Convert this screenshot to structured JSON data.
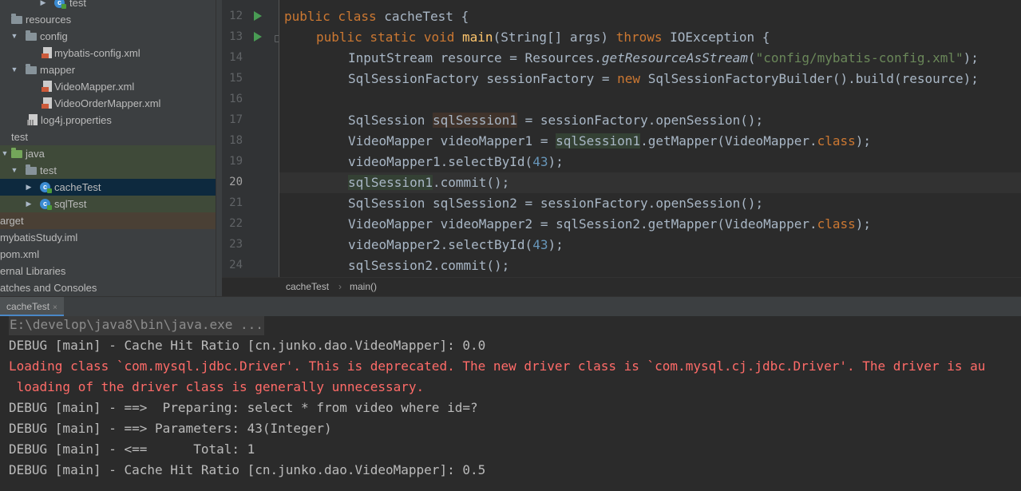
{
  "project_tree": {
    "items": [
      {
        "label": "test",
        "icon": "class-icon"
      },
      {
        "label": "resources",
        "icon": "folder-icon"
      },
      {
        "label": "config",
        "icon": "folder-icon"
      },
      {
        "label": "mybatis-config.xml",
        "icon": "xml-file-icon"
      },
      {
        "label": "mapper",
        "icon": "folder-icon"
      },
      {
        "label": "VideoMapper.xml",
        "icon": "xml-file-icon"
      },
      {
        "label": "VideoOrderMapper.xml",
        "icon": "xml-file-icon"
      },
      {
        "label": "log4j.properties",
        "icon": "properties-file-icon"
      },
      {
        "label": "test",
        "icon": "none"
      },
      {
        "label": "java",
        "icon": "source-folder-icon"
      },
      {
        "label": "test",
        "icon": "folder-icon"
      },
      {
        "label": "cacheTest",
        "icon": "class-icon"
      },
      {
        "label": "sqlTest",
        "icon": "class-icon"
      },
      {
        "label": "arget",
        "icon": "none"
      },
      {
        "label": "mybatisStudy.iml",
        "icon": "none"
      },
      {
        "label": "pom.xml",
        "icon": "none"
      },
      {
        "label": "ernal Libraries",
        "icon": "none"
      },
      {
        "label": "atches and Consoles",
        "icon": "none"
      }
    ]
  },
  "editor": {
    "line_numbers": [
      "12",
      "13",
      "14",
      "15",
      "16",
      "17",
      "18",
      "19",
      "20",
      "21",
      "22",
      "23",
      "24"
    ],
    "current_line": "20",
    "lines": {
      "l12": {
        "a": "public class ",
        "b": "cacheTest {"
      },
      "l13": {
        "a": "public static void ",
        "b": "main",
        "c": "(String[] args) ",
        "d": "throws ",
        "e": "IOException {"
      },
      "l14": {
        "a": "InputStream resource = Resources.",
        "b": "getResourceAsStream",
        "c": "(",
        "d": "\"config/mybatis-config.xml\"",
        "e": ");"
      },
      "l15": {
        "a": "SqlSessionFactory sessionFactory = ",
        "b": "new ",
        "c": "SqlSessionFactoryBuilder().build(resource);"
      },
      "l16": {
        "a": ""
      },
      "l17": {
        "a": "SqlSession ",
        "b": "sqlSession1",
        "c": " = sessionFactory.openSession();"
      },
      "l18": {
        "a": "VideoMapper videoMapper1 = ",
        "b": "sqlSession1",
        "c": ".getMapper(VideoMapper.",
        "d": "class",
        "e": ");"
      },
      "l19": {
        "a": "videoMapper1.selectById(",
        "b": "43",
        "c": ");"
      },
      "l20": {
        "a": "sqlSession1",
        "b": ".commit();"
      },
      "l21": {
        "a": "SqlSession sqlSession2 = sessionFactory.openSession();"
      },
      "l22": {
        "a": "VideoMapper videoMapper2 = sqlSession2.getMapper(VideoMapper.",
        "b": "class",
        "c": ");"
      },
      "l23": {
        "a": "videoMapper2.selectById(",
        "b": "43",
        "c": ");"
      },
      "l24": {
        "a": "sqlSession2.commit();"
      }
    }
  },
  "breadcrumb": {
    "items": [
      "cacheTest",
      "main()"
    ],
    "separator": "›"
  },
  "run_panel": {
    "tab_label": "cacheTest",
    "tab_close": "×",
    "console_lines": [
      "E:\\develop\\java8\\bin\\java.exe ...",
      "DEBUG [main] - Cache Hit Ratio [cn.junko.dao.VideoMapper]: 0.0",
      "Loading class `com.mysql.jdbc.Driver'. This is deprecated. The new driver class is `com.mysql.cj.jdbc.Driver'. The driver is au",
      " loading of the driver class is generally unnecessary.",
      "DEBUG [main] - ==>  Preparing: select * from video where id=?",
      "DEBUG [main] - ==> Parameters: 43(Integer)",
      "DEBUG [main] - <==      Total: 1",
      "DEBUG [main] - Cache Hit Ratio [cn.junko.dao.VideoMapper]: 0.5"
    ]
  },
  "colors": {
    "editor_bg": "#2b2b2b",
    "tree_bg": "#3c3f41",
    "keyword": "#cc7832",
    "string": "#6a8759",
    "number": "#6897bb",
    "method_decl": "#ffc66d",
    "error_text": "#ff6b68",
    "selection": "#0d293e"
  }
}
